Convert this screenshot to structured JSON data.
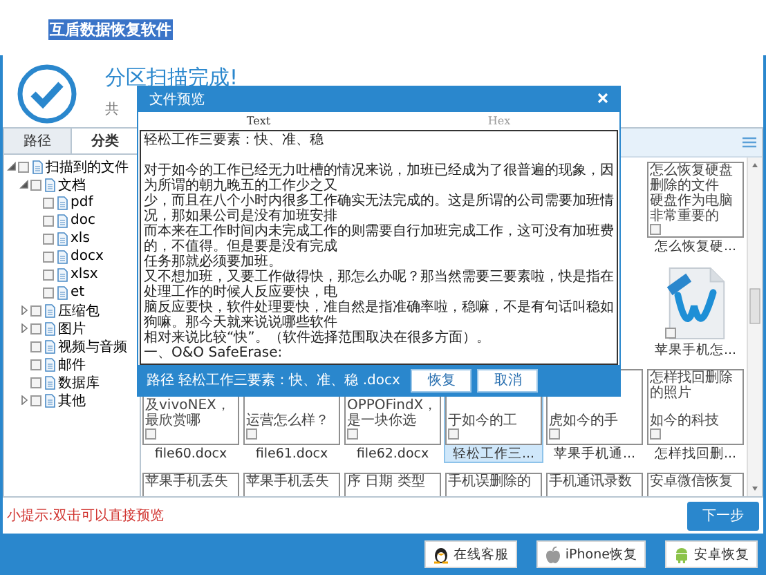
{
  "app_title": "互盾数据恢复软件",
  "scan": {
    "title": "分区扫描完成!",
    "summary": "共"
  },
  "sidebar": {
    "tabs": [
      {
        "label": "路径",
        "selected": false
      },
      {
        "label": "分类",
        "selected": true
      }
    ],
    "tree": [
      {
        "label": "扫描到的文件",
        "checked": false,
        "expanded": true,
        "children": [
          {
            "label": "文档",
            "checked": false,
            "expanded": true,
            "children": [
              {
                "label": "pdf",
                "checked": false
              },
              {
                "label": "doc",
                "checked": false
              },
              {
                "label": "xls",
                "checked": false
              },
              {
                "label": "docx",
                "checked": false
              },
              {
                "label": "xlsx",
                "checked": false
              },
              {
                "label": "et",
                "checked": false
              }
            ]
          },
          {
            "label": "压缩包",
            "checked": false,
            "expanded": false
          },
          {
            "label": "图片",
            "checked": false,
            "expanded": false
          },
          {
            "label": "视频与音频",
            "checked": false
          },
          {
            "label": "邮件",
            "checked": false
          },
          {
            "label": "数据库",
            "checked": false
          },
          {
            "label": "其他",
            "checked": false,
            "expanded": false
          }
        ]
      }
    ]
  },
  "file_grid": {
    "upper_items": [
      {
        "kind": "text",
        "top_lines": [
          "怎么恢复硬盘",
          "删除的文件"
        ],
        "bottom_lines": [
          "硬盘作为电脑",
          "非常重要的"
        ],
        "label": "怎么恢复硬...",
        "checked": false,
        "selected": false
      },
      {
        "kind": "word",
        "label": "苹果手机怎...",
        "checked": false,
        "selected": false
      }
    ],
    "rows": [
      [
        {
          "kind": "text",
          "bottom_lines": [
            "及vivoNEX，",
            "最欣赏哪"
          ],
          "label": "file60.docx",
          "checked": false,
          "selected": false
        },
        {
          "kind": "text",
          "bottom_lines": [
            "运营怎么样？"
          ],
          "label": "file61.docx",
          "checked": false,
          "selected": false
        },
        {
          "kind": "text",
          "bottom_lines": [
            "OPPOFindX，",
            "是一块你选"
          ],
          "label": "file62.docx",
          "checked": false,
          "selected": false
        },
        {
          "kind": "text",
          "bottom_lines": [
            "于如今的工"
          ],
          "label": "轻松工作三...",
          "checked": false,
          "selected": true
        },
        {
          "kind": "text",
          "bottom_lines": [
            "虎如今的手"
          ],
          "label": "苹果手机通...",
          "checked": false,
          "selected": false
        },
        {
          "kind": "text",
          "top_lines": [
            "怎样找回删除",
            "的照片"
          ],
          "bottom_lines": [
            "如今的科技"
          ],
          "label": "怎样找回删...",
          "checked": false,
          "selected": false
        }
      ],
      [
        {
          "kind": "text",
          "top_lines": [
            "苹果手机丢失"
          ],
          "selected": false
        },
        {
          "kind": "text",
          "top_lines": [
            "苹果手机丢失"
          ],
          "selected": false
        },
        {
          "kind": "text",
          "top_lines": [
            "序 日期 类型"
          ],
          "selected": false
        },
        {
          "kind": "text",
          "top_lines": [
            "手机误删除的"
          ],
          "selected": false
        },
        {
          "kind": "text",
          "top_lines": [
            "手机通讯录数"
          ],
          "selected": false
        },
        {
          "kind": "text",
          "top_lines": [
            "安卓微信恢复"
          ],
          "selected": false
        }
      ]
    ]
  },
  "preview_dialog": {
    "title": "文件预览",
    "tabs": [
      {
        "label": "Text",
        "selected": true
      },
      {
        "label": "Hex",
        "selected": false
      }
    ],
    "lines": [
      "轻松工作三要素：快、准、稳",
      "对于如今的工作已经无力吐槽的情况来说，加班已经成为了很普遍的现象，因为所谓的朝九晚五的工作少之又",
      "少，而且在八个小时内很多工作确实无法完成的。这是所谓的公司需要加班情况，那如果公司是没有加班安排",
      "而本来在工作时间内未完成工作的则需要自行加班完成工作，这可没有加班费的，不值得。但是要是没有完成",
      "任务那就必须要加班。",
      "又不想加班，又要工作做得快，那怎么办呢？那当然需要三要素啦，快是指在处理工作的时候人反应要快，电",
      "脑反应要快，软件处理要快，准自然是指准确率啦，稳嘛，不是有句话叫稳如狗嘛。那今天就来说说哪些软件",
      "相对来说比较“快”。（软件选择范围取决在很多方面）。",
      "一、O&O SafeErase:"
    ],
    "path": "路径 轻松工作三要素：快、准、稳 .docx",
    "buttons": [
      "恢复",
      "取消"
    ]
  },
  "hint": "小提示:双击可以直接预览",
  "next_button": "下一步",
  "footer_buttons": [
    {
      "label": "在线客服",
      "kind": "qq"
    },
    {
      "label": "iPhone恢复",
      "kind": "apple"
    },
    {
      "label": "安卓恢复",
      "kind": "android"
    }
  ]
}
